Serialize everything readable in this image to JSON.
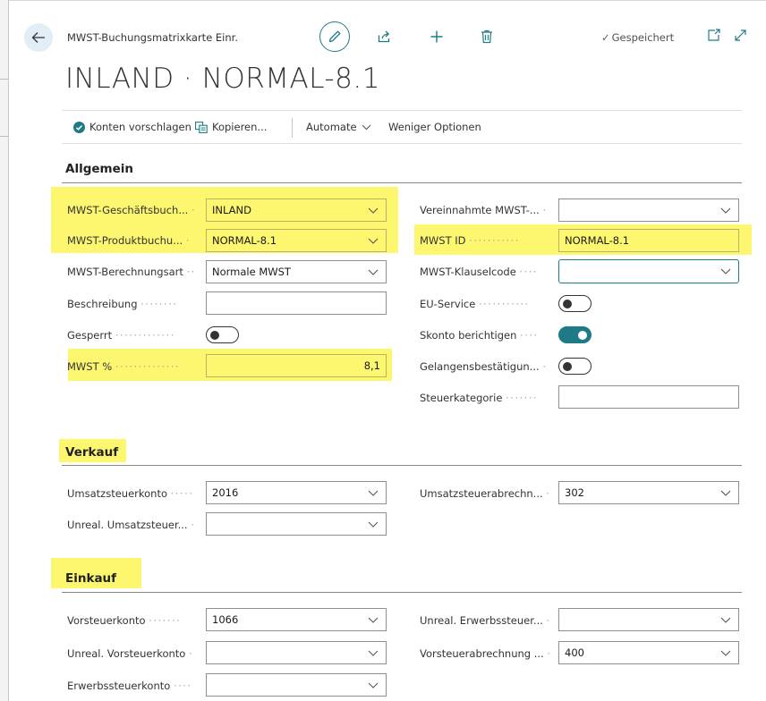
{
  "header": {
    "breadcrumb": "MWST-Buchungsmatrixkarte Einr.",
    "title": "INLAND · NORMAL-8.1",
    "status": "Gespeichert"
  },
  "actions": {
    "suggest_accounts": "Konten vorschlagen",
    "copy": "Kopieren...",
    "automate": "Automate",
    "fewer_options": "Weniger Optionen"
  },
  "sections": {
    "general": "Allgemein",
    "sales": "Verkauf",
    "purchase": "Einkauf"
  },
  "general": {
    "bus_posting_group": {
      "label": "MWST-Geschäftsbuch...",
      "value": "INLAND"
    },
    "prod_posting_group": {
      "label": "MWST-Produktbuchu...",
      "value": "NORMAL-8.1"
    },
    "calc_type": {
      "label": "MWST-Berechnungsart",
      "value": "Normale MWST"
    },
    "description": {
      "label": "Beschreibung",
      "value": ""
    },
    "blocked": {
      "label": "Gesperrt",
      "on": false
    },
    "vat_percent": {
      "label": "MWST %",
      "value": "8,1"
    },
    "collected_vat": {
      "label": "Vereinnahmte MWST-...",
      "value": ""
    },
    "vat_id": {
      "label": "MWST ID",
      "value": "NORMAL-8.1"
    },
    "clause_code": {
      "label": "MWST-Klauselcode",
      "value": ""
    },
    "eu_service": {
      "label": "EU-Service",
      "on": false
    },
    "adjust_discount": {
      "label": "Skonto berichtigen",
      "on": true
    },
    "certificate": {
      "label": "Gelangensbestätigun...",
      "on": false
    },
    "tax_category": {
      "label": "Steuerkategorie",
      "value": ""
    }
  },
  "sales": {
    "sales_vat_account": {
      "label": "Umsatzsteuerkonto",
      "value": "2016"
    },
    "unreal_sales_vat": {
      "label": "Unreal. Umsatzsteuer...",
      "value": ""
    },
    "sales_vat_settlement": {
      "label": "Umsatzsteuerabrechn...",
      "value": "302"
    }
  },
  "purchase": {
    "purchase_vat_account": {
      "label": "Vorsteuerkonto",
      "value": "1066"
    },
    "unreal_purchase_vat": {
      "label": "Unreal. Vorsteuerkonto",
      "value": ""
    },
    "reverse_charge_account": {
      "label": "Erwerbssteuerkonto",
      "value": ""
    },
    "unreal_reverse_charge": {
      "label": "Unreal. Erwerbssteuer...",
      "value": ""
    },
    "purchase_vat_settlement": {
      "label": "Vorsteuerabrechnung ...",
      "value": "400"
    }
  },
  "colors": {
    "accent": "#1e7b86",
    "highlight": "#fdf66f"
  }
}
